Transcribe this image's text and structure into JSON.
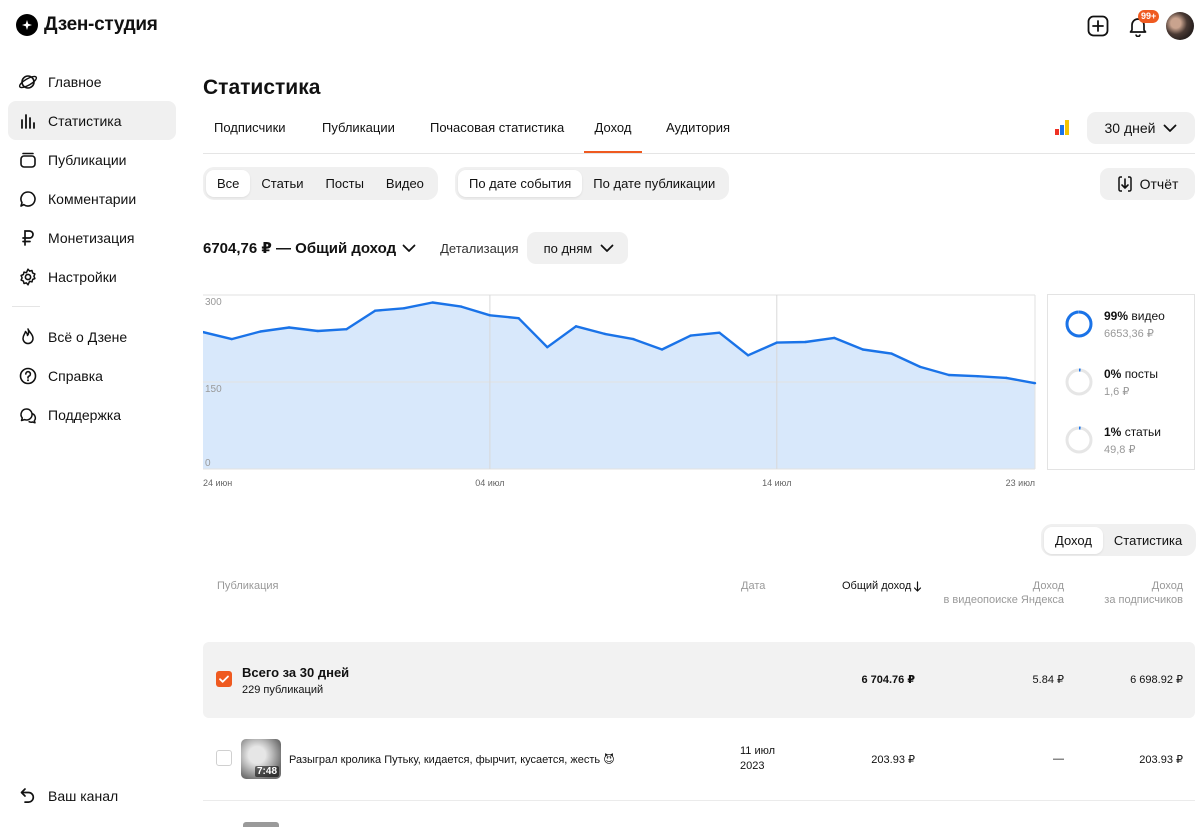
{
  "app": {
    "title": "Дзен-студия"
  },
  "header": {
    "notif_badge": "99+"
  },
  "sidebar": {
    "items": [
      {
        "label": "Главное",
        "icon": "planet-icon"
      },
      {
        "label": "Статистика",
        "icon": "bar-chart-icon",
        "active": true
      },
      {
        "label": "Публикации",
        "icon": "publications-icon"
      },
      {
        "label": "Комментарии",
        "icon": "comment-icon"
      },
      {
        "label": "Монетизация",
        "icon": "ruble-icon"
      },
      {
        "label": "Настройки",
        "icon": "gear-icon"
      }
    ],
    "items2": [
      {
        "label": "Всё о Дзене",
        "icon": "fire-icon"
      },
      {
        "label": "Справка",
        "icon": "help-icon"
      },
      {
        "label": "Поддержка",
        "icon": "support-chat-icon"
      }
    ],
    "bottom": {
      "label": "Ваш канал",
      "icon": "back-arrow-icon"
    }
  },
  "page": {
    "title": "Статистика",
    "tabs": [
      {
        "label": "Подписчики"
      },
      {
        "label": "Публикации"
      },
      {
        "label": "Почасовая статистика"
      },
      {
        "label": "Доход",
        "active": true
      },
      {
        "label": "Аудитория"
      }
    ],
    "period": "30 дней"
  },
  "filters": {
    "types": [
      {
        "label": "Все",
        "selected": true
      },
      {
        "label": "Статьи"
      },
      {
        "label": "Посты"
      },
      {
        "label": "Видео"
      }
    ],
    "date_modes": [
      {
        "label": "По дате события",
        "selected": true
      },
      {
        "label": "По дате публикации"
      }
    ],
    "report_label": "Отчёт"
  },
  "summary_bar": {
    "total": "6704,76 ₽ — Общий доход",
    "detail_label": "Детализация",
    "detail_value": "по дням"
  },
  "chart_data": {
    "type": "area",
    "x": [
      "24 июн",
      "25 июн",
      "26 июн",
      "27 июн",
      "28 июн",
      "29 июн",
      "30 июн",
      "01 июл",
      "02 июл",
      "03 июл",
      "04 июл",
      "05 июл",
      "06 июл",
      "07 июл",
      "08 июл",
      "09 июл",
      "10 июл",
      "11 июл",
      "12 июл",
      "13 июл",
      "14 июл",
      "15 июл",
      "16 июл",
      "17 июл",
      "18 июл",
      "19 июл",
      "20 июл",
      "21 июл",
      "22 июл",
      "23 июл"
    ],
    "series": [
      {
        "values": [
          236,
          224,
          237,
          244,
          238,
          241,
          273,
          277,
          287,
          280,
          265,
          260,
          210,
          246,
          233,
          224,
          206,
          230,
          235,
          196,
          218,
          219,
          226,
          206,
          199,
          176,
          162,
          160,
          157,
          148
        ]
      }
    ],
    "ylim": [
      0,
      300
    ],
    "yticks": [
      "300",
      "150",
      "0"
    ],
    "xticks": [
      "24 июн",
      "04 июл",
      "14 июл",
      "23 июл"
    ],
    "grid": true,
    "color": "#1a73e8",
    "fill": "#d8e8fb"
  },
  "breakdown": [
    {
      "pct": "99%",
      "label": "видео",
      "value": "6653,36 ₽",
      "fraction": 0.99
    },
    {
      "pct": "0%",
      "label": "посты",
      "value": "1,6 ₽",
      "fraction": 0.003
    },
    {
      "pct": "1%",
      "label": "статьи",
      "value": "49,8 ₽",
      "fraction": 0.01
    }
  ],
  "table": {
    "toggle": [
      {
        "label": "Доход",
        "selected": true
      },
      {
        "label": "Статистика"
      }
    ],
    "columns": {
      "publication": "Публикация",
      "date": "Дата",
      "total": "Общий доход",
      "search_1": "Доход",
      "search_2": "в видеопоиске Яндекса",
      "subs_1": "Доход",
      "subs_2": "за подписчиков"
    },
    "summary": {
      "title": "Всего за 30 дней",
      "subtitle": "229 публикаций",
      "total": "6 704.76 ₽",
      "search": "5.84 ₽",
      "subs": "6 698.92 ₽"
    },
    "rows": [
      {
        "title": "Разыграл кролика Путьку, кидается, фырчит, кусается, жесть 😈",
        "duration": "7:48",
        "date_1": "11 июл",
        "date_2": "2023",
        "total": "203.93 ₽",
        "search": "—",
        "subs": "203.93 ₽"
      }
    ]
  }
}
